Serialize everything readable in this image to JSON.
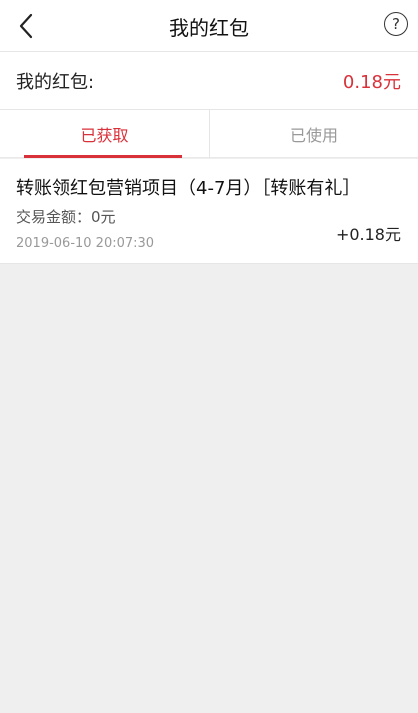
{
  "colors": {
    "accent": "#d9313a",
    "muted_tab": "#999999"
  },
  "header": {
    "back_icon": "chevron-left-icon",
    "title": "我的红包",
    "help_icon": "question-circle-icon",
    "help_glyph": "?"
  },
  "summary": {
    "label": "我的红包:",
    "amount": "0.18元"
  },
  "tabs": [
    {
      "label": "已获取",
      "active": true
    },
    {
      "label": "已使用",
      "active": false
    }
  ],
  "records": [
    {
      "title": "转账领红包营销项目（4-7月）［转账有礼］",
      "trade_label": "交易金额：",
      "trade_amount": "0元",
      "time": "2019-06-10 20:07:30",
      "amount": "+0.18元"
    }
  ]
}
